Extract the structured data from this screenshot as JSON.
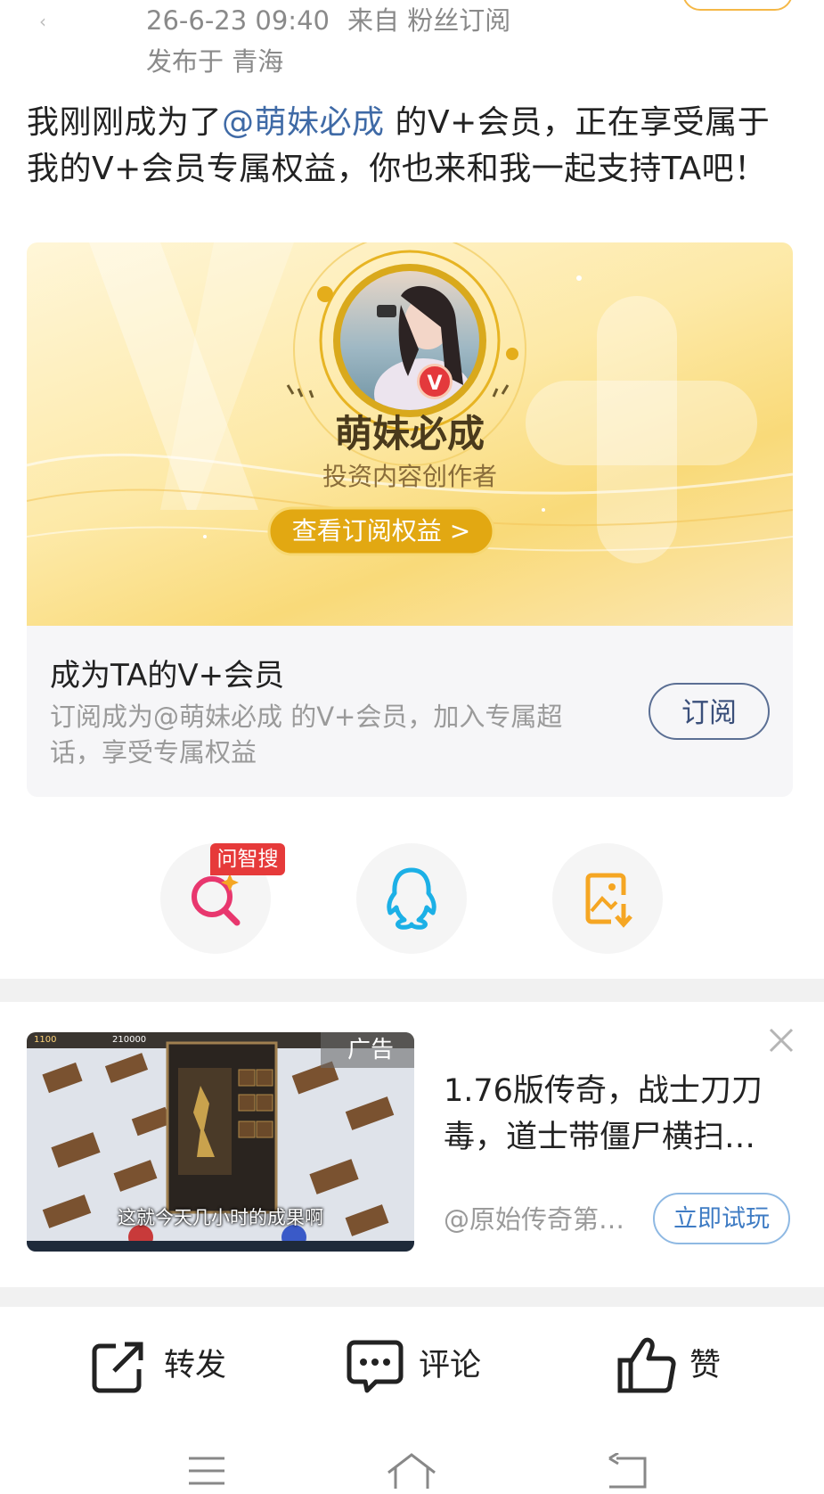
{
  "header": {
    "date": "26-6-23 09:40",
    "source": "来自 粉丝订阅",
    "location": "发布于 青海"
  },
  "post": {
    "text_before": "我刚刚成为了",
    "mention": "@萌妹必成",
    "text_after": " 的V+会员，正在享受属于我的V+会员专属权益，你也来和我一起支持TA吧！"
  },
  "vip_card": {
    "name": "萌妹必成",
    "role": "投资内容创作者",
    "view_button": "查看订阅权益",
    "view_chevron": ">",
    "badge_text": "V",
    "title": "成为TA的V+会员",
    "desc": "订阅成为@萌妹必成 的V+会员，加入专属超话，享受专属权益",
    "subscribe_button": "订阅"
  },
  "share": {
    "badge": "问智搜",
    "icons": [
      "search-sparkle-icon",
      "qq-icon",
      "save-image-icon"
    ]
  },
  "ad": {
    "tag": "广告",
    "caption": "这就今天几小时的成果啊",
    "hud_left": "1100",
    "hud_mid": "210000",
    "title": "1.76版传奇，战士刀刀毒，道士带僵尸横扫…",
    "source": "@原始传奇第…",
    "button": "立即试玩"
  },
  "actions": {
    "repost": "转发",
    "comment": "评论",
    "like": "赞"
  },
  "colors": {
    "mention": "#3f6aa6",
    "badge_red": "#e63a3a",
    "gold": "#e9b61f",
    "ad_button": "#3f7cc4"
  }
}
